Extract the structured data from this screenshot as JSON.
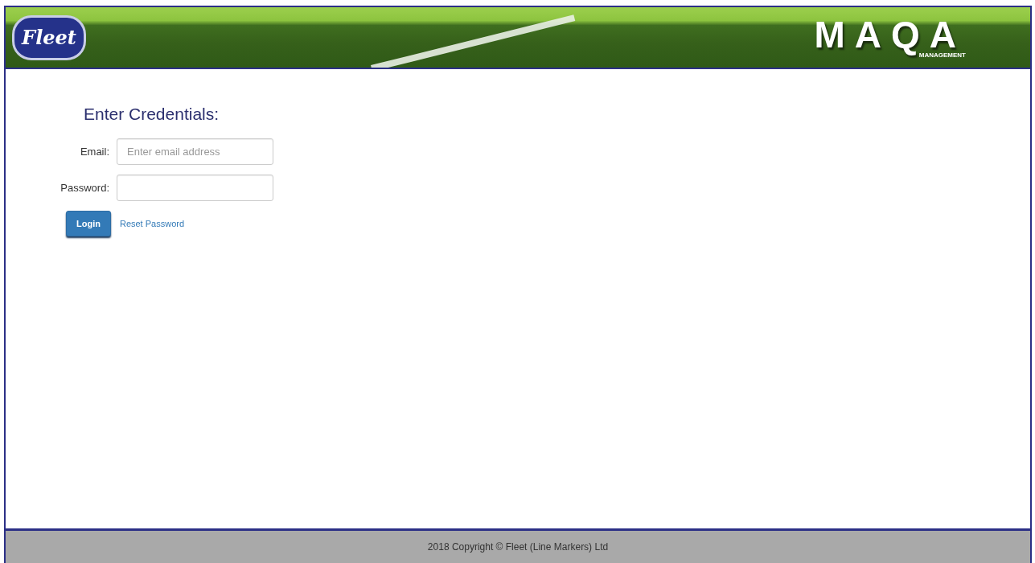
{
  "header": {
    "left_logo": "Fleet",
    "right_logo": "MAQA",
    "right_logo_tagline": "MANAGEMENT"
  },
  "form": {
    "heading": "Enter Credentials:",
    "email_field": {
      "label": "Email:",
      "placeholder": "Enter email address"
    },
    "password_field": {
      "label": "Password:"
    },
    "login_button": "Login",
    "reset_link": "Reset Password"
  },
  "footer": "2018 Copyright © Fleet (Line Markers) Ltd"
}
